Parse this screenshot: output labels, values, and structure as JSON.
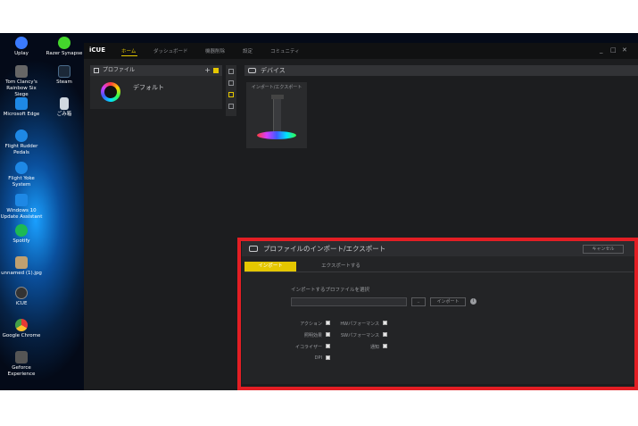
{
  "desktop_icons": [
    {
      "label": "Uplay",
      "icon": "uplay-icon",
      "color": "#3b7bff"
    },
    {
      "label": "Razer Synapse",
      "icon": "razer-icon",
      "color": "#44d62c"
    },
    {
      "label": "Tom Clancy's Rainbow Six Siege",
      "icon": "rainbow-six-icon",
      "color": "#666666"
    },
    {
      "label": "Steam",
      "icon": "steam-icon",
      "color": "#1b2838"
    },
    {
      "label": "Microsoft Edge",
      "icon": "edge-icon",
      "color": "#1e88e5"
    },
    {
      "label": "ごみ箱",
      "icon": "recycle-bin-icon",
      "color": "#d0d8e0"
    },
    {
      "label": "Flight Rudder Pedals",
      "icon": "logitech-icon",
      "color": "#1e88e5"
    },
    {
      "label": "Flight Yoke System",
      "icon": "logitech-icon",
      "color": "#1e88e5"
    },
    {
      "label": "Windows 10 Update Assistant",
      "icon": "windows-icon",
      "color": "#1e88e5"
    },
    {
      "label": "Spotify",
      "icon": "spotify-icon",
      "color": "#1db954"
    },
    {
      "label": "unnamed (1).jpg",
      "icon": "image-file-icon",
      "color": "#c0a070"
    },
    {
      "label": "iCUE",
      "icon": "icue-icon",
      "color": "#333333"
    },
    {
      "label": "Google Chrome",
      "icon": "chrome-icon",
      "color": "#e53935"
    },
    {
      "label": "Geforce Experience",
      "icon": "geforce-icon",
      "color": "#555555"
    }
  ],
  "app": {
    "logo": "iCUE",
    "tabs": [
      {
        "label": "ホーム",
        "active": true
      },
      {
        "label": "ダッシュボード",
        "active": false
      },
      {
        "label": "機器削除",
        "active": false
      },
      {
        "label": "設定",
        "active": false
      },
      {
        "label": "コミュニティ",
        "active": false
      }
    ],
    "window_controls": {
      "minimize": "_",
      "maximize": "□",
      "close": "✕"
    },
    "profile_panel": {
      "title": "プロファイル",
      "add": "+",
      "profile_name": "デフォルト"
    },
    "device_panel": {
      "title": "デバイス",
      "device_label": "インポート/エクスポート"
    },
    "dialog": {
      "title": "プロファイルのインポート/エクスポート",
      "cancel": "キャンセル",
      "tabs": [
        "インポート",
        "エクスポートする"
      ],
      "select_label": "インポートするプロファイルを選択",
      "path_value": "",
      "browse": "..",
      "import_button": "インポート",
      "info": "i",
      "options_left": [
        "アクション",
        "照明効果",
        "イコライザー",
        "DPI"
      ],
      "options_right": [
        "HWパフォーマンス",
        "SWパフォーマンス",
        "通知"
      ]
    }
  },
  "colors": {
    "accent": "#e5c700",
    "highlight_frame": "#e31e24"
  }
}
